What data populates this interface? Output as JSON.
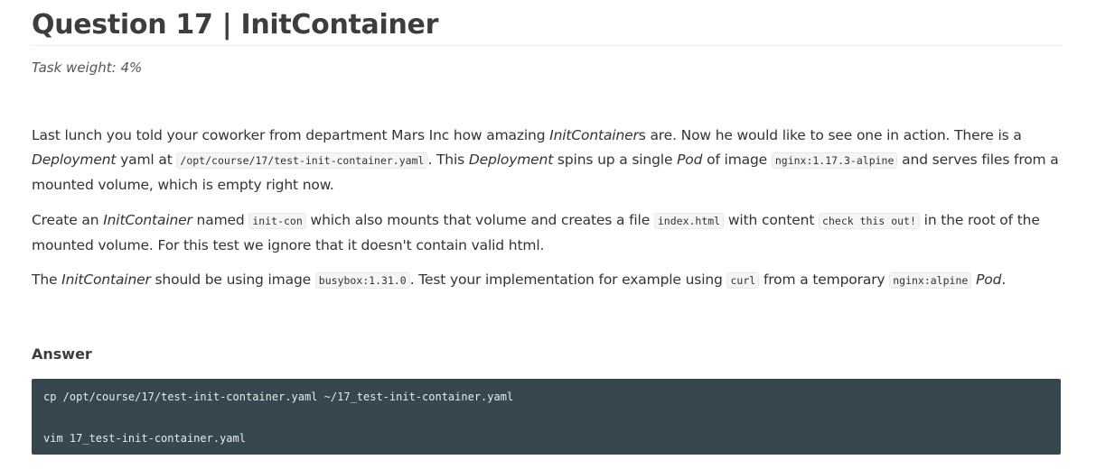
{
  "title": "Question 17 | InitContainer",
  "task_weight": "Task weight: 4%",
  "p1": {
    "t1": "Last lunch you told your coworker from department Mars Inc how amazing ",
    "e1": "InitContainer",
    "t2": "s are. Now he would like to see one in action. There is a ",
    "e2": "Deployment",
    "t3": " yaml at ",
    "c1": "/opt/course/17/test-init-container.yaml",
    "t4": ". This ",
    "e3": "Deployment",
    "t5": " spins up a single ",
    "e4": "Pod",
    "t6": " of image ",
    "c2": "nginx:1.17.3-alpine",
    "t7": " and serves files from a mounted volume, which is empty right now."
  },
  "p2": {
    "t1": "Create an ",
    "e1": "InitContainer",
    "t2": " named ",
    "c1": "init-con",
    "t3": " which also mounts that volume and creates a file ",
    "c2": "index.html",
    "t4": " with content ",
    "c3": "check this out!",
    "t5": " in the root of the mounted volume. For this test we ignore that it doesn't contain valid html."
  },
  "p3": {
    "t1": "The ",
    "e1": "InitContainer",
    "t2": " should be using image ",
    "c1": "busybox:1.31.0",
    "t3": ". Test your implementation for example using ",
    "c2": "curl",
    "t4": " from a temporary ",
    "c3": "nginx:alpine",
    "t5": " ",
    "e2": "Pod",
    "t6": "."
  },
  "answer_heading": "Answer",
  "code_lines": [
    "cp /opt/course/17/test-init-container.yaml ~/17_test-init-container.yaml",
    "vim 17_test-init-container.yaml"
  ],
  "colors": {
    "code_background": "#37474f",
    "code_text": "#e8eaeb",
    "heading": "#3d3d3d",
    "body_text": "#333333"
  }
}
